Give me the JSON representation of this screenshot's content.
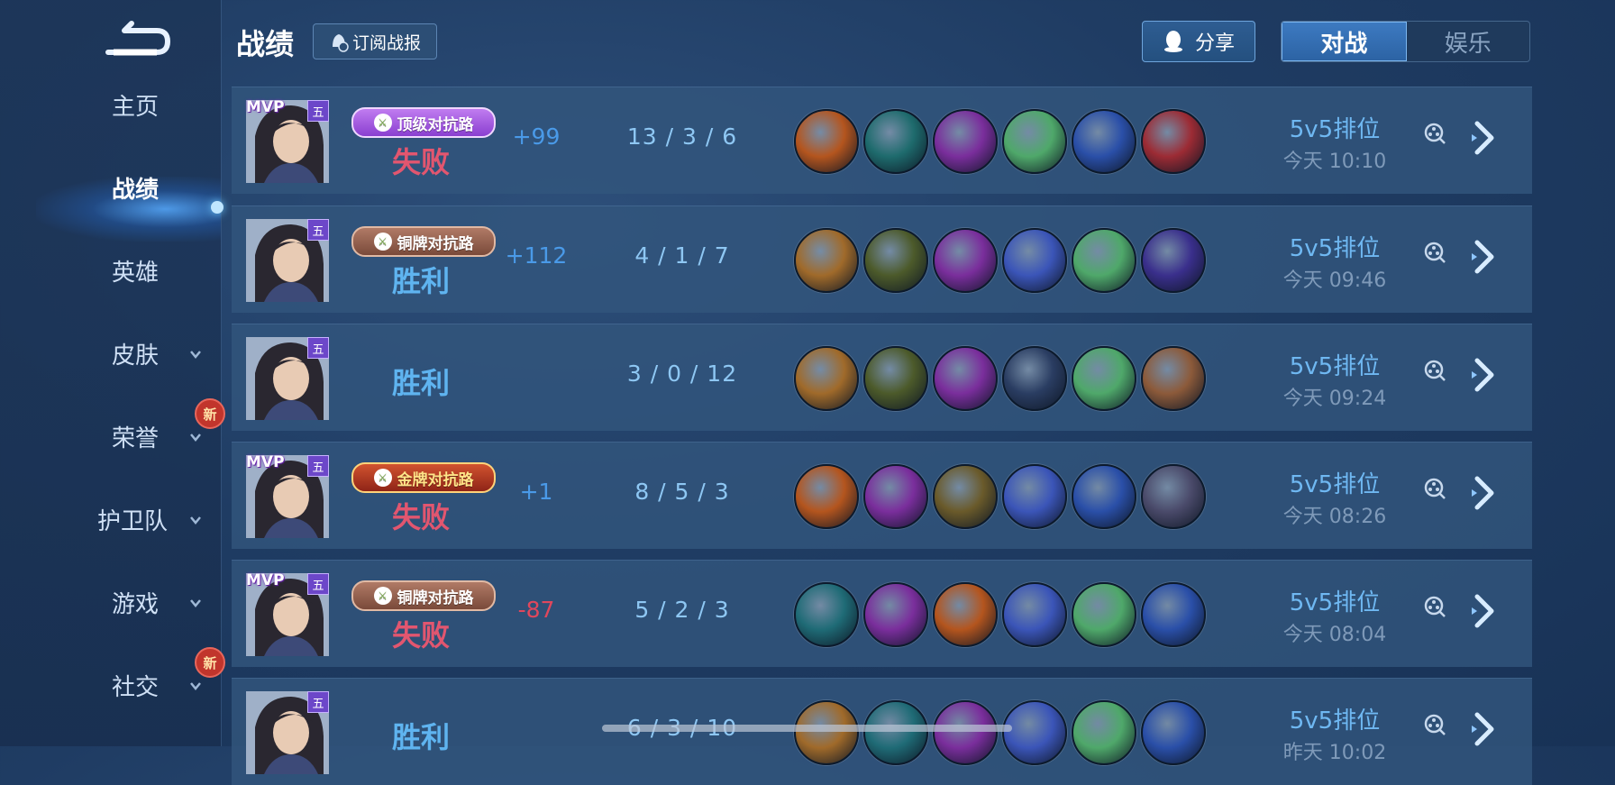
{
  "header": {
    "title": "战绩",
    "subscribe_label": "订阅战报",
    "share_label": "分享",
    "tabs": [
      {
        "label": "对战",
        "active": true
      },
      {
        "label": "娱乐",
        "active": false
      }
    ]
  },
  "sidebar": {
    "items": [
      {
        "label": "主页",
        "active": false,
        "has_chevron": false,
        "new": false
      },
      {
        "label": "战绩",
        "active": true,
        "has_chevron": false,
        "new": false
      },
      {
        "label": "英雄",
        "active": false,
        "has_chevron": false,
        "new": false
      },
      {
        "label": "皮肤",
        "active": false,
        "has_chevron": true,
        "new": false
      },
      {
        "label": "荣誉",
        "active": false,
        "has_chevron": true,
        "new": true
      },
      {
        "label": "护卫队",
        "active": false,
        "has_chevron": true,
        "new": false
      },
      {
        "label": "游戏",
        "active": false,
        "has_chevron": true,
        "new": false
      },
      {
        "label": "社交",
        "active": false,
        "has_chevron": true,
        "new": true
      }
    ],
    "new_badge": "新"
  },
  "matches": [
    {
      "mvp": "MVP",
      "rank_tag": "五",
      "lane": "顶级对抗路",
      "lane_style": "top",
      "result": "失败",
      "score": "+99",
      "kda": "13 / 3 / 6",
      "mode": "5v5排位",
      "time": "今天 10:10",
      "items": [
        "#b4551e",
        "#1e6b6d",
        "#7a2e9c",
        "#4fa86a",
        "#2a4fa8",
        "#9c2b34"
      ]
    },
    {
      "mvp": "",
      "rank_tag": "五",
      "lane": "铜牌对抗路",
      "lane_style": "bronze",
      "result": "胜利",
      "score": "+112",
      "kda": "4 / 1 / 7",
      "mode": "5v5排位",
      "time": "今天 09:46",
      "items": [
        "#a06a2a",
        "#4c5a2a",
        "#7a2e9c",
        "#3b55b8",
        "#4fa86a",
        "#3a2f8c"
      ]
    },
    {
      "mvp": "",
      "rank_tag": "五",
      "lane": "",
      "lane_style": "",
      "result": "胜利",
      "score": "",
      "kda": "3 / 0 / 12",
      "mode": "5v5排位",
      "time": "今天 09:24",
      "items": [
        "#a06a2a",
        "#4c5a2a",
        "#7a2e9c",
        "#2a3d62",
        "#4fa86a",
        "#8c5a3a"
      ]
    },
    {
      "mvp": "MVP",
      "rank_tag": "五",
      "lane": "金牌对抗路",
      "lane_style": "gold",
      "result": "失败",
      "score": "+1",
      "kda": "8 / 5 / 3",
      "mode": "5v5排位",
      "time": "今天 08:26",
      "items": [
        "#b4551e",
        "#7a2e9c",
        "#6a5a2a",
        "#3b55b8",
        "#2a4fa8",
        "#4a4a6a"
      ]
    },
    {
      "mvp": "MVP",
      "rank_tag": "五",
      "lane": "铜牌对抗路",
      "lane_style": "bronze",
      "result": "失败",
      "score": "-87",
      "kda": "5 / 2 / 3",
      "mode": "5v5排位",
      "time": "今天 08:04",
      "items": [
        "#1f6b76",
        "#7a2e9c",
        "#b4551e",
        "#3b55b8",
        "#4fa86a",
        "#2a4fa8"
      ]
    },
    {
      "mvp": "",
      "rank_tag": "五",
      "lane": "",
      "lane_style": "",
      "result": "胜利",
      "score": "",
      "kda": "6 / 3 / 10",
      "mode": "5v5排位",
      "time": "昨天 10:02",
      "items": [
        "#a06a2a",
        "#1f6b76",
        "#7a2e9c",
        "#3b55b8",
        "#4fa86a",
        "#2a4fa8"
      ]
    }
  ]
}
